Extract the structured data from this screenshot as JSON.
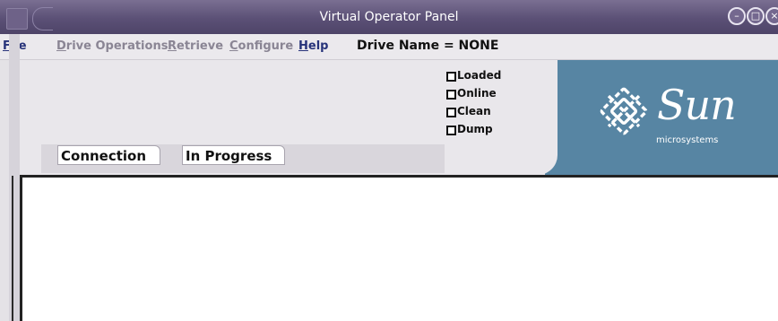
{
  "window": {
    "title": "Virtual Operator Panel"
  },
  "menu": [
    {
      "label": "File",
      "underline": "F",
      "rest": "ile",
      "active": true
    },
    {
      "label": "Drive Operations",
      "underline": "D",
      "rest": "rive Operations",
      "active": false
    },
    {
      "label": "Retrieve",
      "underline": "R",
      "rest": "etrieve",
      "active": false
    },
    {
      "label": "Configure",
      "underline": "C",
      "rest": "onfigure",
      "active": false
    },
    {
      "label": "Help",
      "underline": "H",
      "rest": "elp",
      "active": true
    }
  ],
  "drive": {
    "name_label": "Drive Name = NONE"
  },
  "status_fields": {
    "connection": "Connection",
    "progress": "In Progress"
  },
  "indicators": [
    "Loaded",
    "Online",
    "Clean",
    "Dump"
  ],
  "logo": {
    "word": "Sun",
    "subtitle": "microsystems",
    "background": "#5785a3"
  },
  "icons": {
    "minimize": "minimize-icon",
    "maximize": "maximize-icon",
    "close": "close-icon"
  }
}
